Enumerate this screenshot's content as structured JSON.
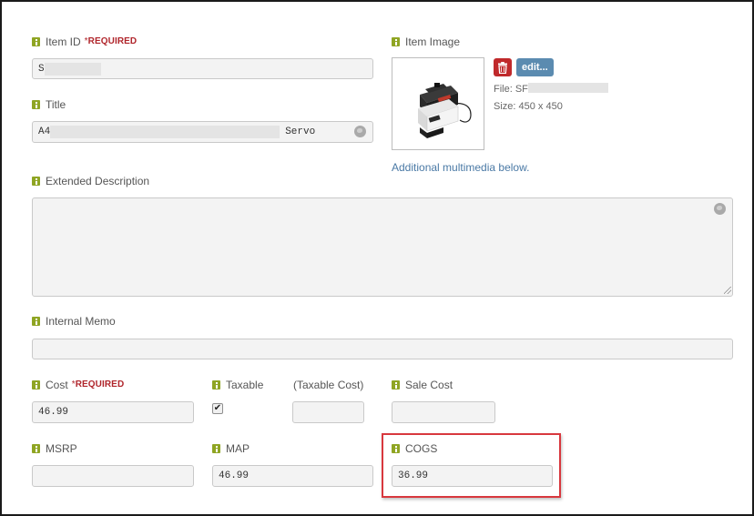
{
  "item_id": {
    "label": "Item ID",
    "required": "REQUIRED",
    "value": "S"
  },
  "title": {
    "label": "Title",
    "value_prefix": "A4",
    "value_suffix": "Servo",
    "globe_icon": "globe-icon"
  },
  "item_image": {
    "label": "Item Image",
    "edit_label": "edit...",
    "delete_icon": "trash-icon",
    "file_label": "File: SF",
    "size_label": "Size: 450 x 450",
    "multimedia_link": "Additional multimedia below."
  },
  "extended_description": {
    "label": "Extended Description",
    "value": ""
  },
  "internal_memo": {
    "label": "Internal Memo",
    "value": ""
  },
  "cost": {
    "label": "Cost",
    "required": "REQUIRED",
    "value": "46.99"
  },
  "taxable": {
    "label": "Taxable",
    "checked": true,
    "check_mark": "✔"
  },
  "taxable_cost": {
    "label": "(Taxable Cost)",
    "value": ""
  },
  "sale_cost": {
    "label": "Sale Cost",
    "value": ""
  },
  "msrp": {
    "label": "MSRP",
    "value": ""
  },
  "map": {
    "label": "MAP",
    "value": "46.99"
  },
  "cogs": {
    "label": "COGS",
    "value": "36.99"
  },
  "colors": {
    "info_icon": "#8fa523",
    "required": "#b0252b",
    "link": "#4a79a5",
    "edit_button": "#5b8bb0",
    "delete_button": "#c0292b",
    "highlight": "#d8383e"
  }
}
